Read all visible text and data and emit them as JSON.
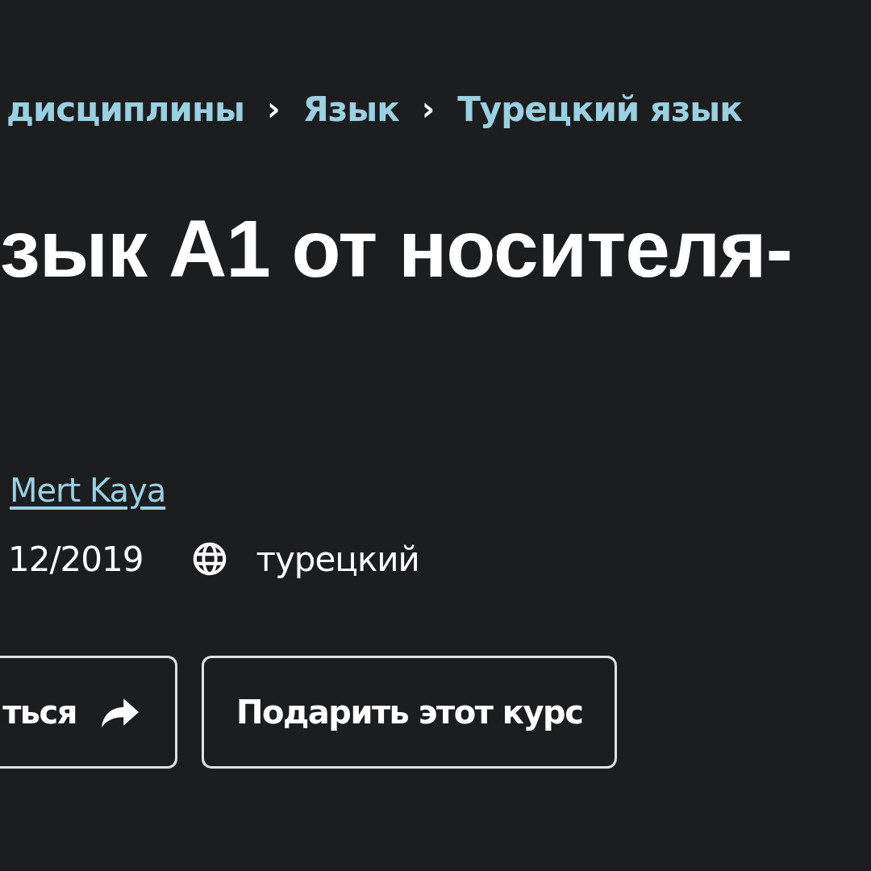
{
  "breadcrumbs": [
    {
      "label": "дисциплины"
    },
    {
      "label": "Язык"
    },
    {
      "label": "Турецкий язык"
    }
  ],
  "breadcrumb_separator": "›",
  "title": "зык A1 от носителя-",
  "author": {
    "name": "Mert Kaya"
  },
  "meta": {
    "date": "12/2019",
    "language": "турецкий"
  },
  "buttons": [
    {
      "label": "ться",
      "kind": "share"
    },
    {
      "label": "Подарить этот курс",
      "kind": "plain"
    }
  ]
}
